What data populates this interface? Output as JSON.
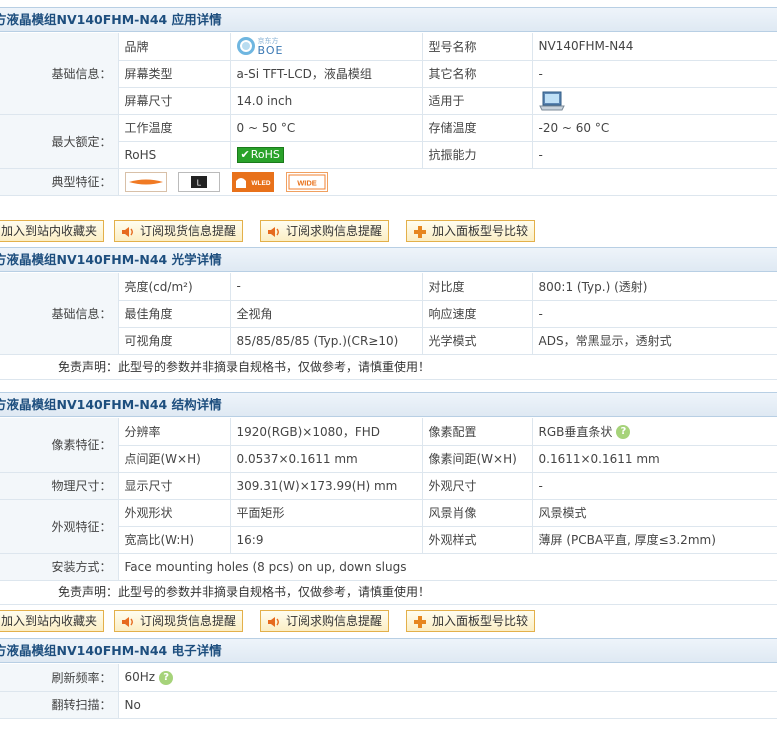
{
  "sections": {
    "app": {
      "title": "方液晶模组NV140FHM-N44 应用详情"
    },
    "optical": {
      "title": "方液晶模组NV140FHM-N44 光学详情"
    },
    "structure": {
      "title": "方液晶模组NV140FHM-N44 结构详情"
    },
    "electronic": {
      "title": "方液晶模组NV140FHM-N44 电子详情"
    }
  },
  "app": {
    "basic_group": "基础信息：",
    "rating_group": "最大额定：",
    "feature_group": "典型特征：",
    "brand_label": "品牌",
    "brand_logo_name": "京东方",
    "brand_logo_text": "BOE",
    "model_label": "型号名称",
    "model_value": "NV140FHM-N44",
    "screen_type_label": "屏幕类型",
    "screen_type_value": "a-Si TFT-LCD，液晶模组",
    "other_name_label": "其它名称",
    "other_name_value": "-",
    "screen_size_label": "屏幕尺寸",
    "screen_size_value": "14.0 inch",
    "suitable_label": "适用于",
    "work_temp_label": "工作温度",
    "work_temp_value": "0 ~ 50 °C",
    "storage_temp_label": "存储温度",
    "storage_temp_value": "-20 ~ 60 °C",
    "rohs_label": "RoHS",
    "rohs_badge": "RoHS",
    "vibration_label": "抗振能力",
    "vibration_value": "-",
    "feature_l": "L",
    "feature_wled": "WLED",
    "feature_wide": "WIDE"
  },
  "actions": {
    "favorite": "加入到站内收藏夹",
    "stock_alert": "订阅现货信息提醒",
    "buy_alert": "订阅求购信息提醒",
    "compare": "加入面板型号比较"
  },
  "optical": {
    "basic_group": "基础信息：",
    "brightness_label": "亮度(cd/m²)",
    "brightness_value": "-",
    "contrast_label": "对比度",
    "contrast_value": "800:1 (Typ.) (透射)",
    "best_angle_label": "最佳角度",
    "best_angle_value": "全视角",
    "response_label": "响应速度",
    "response_value": "-",
    "view_angle_label": "可视角度",
    "view_angle_value": "85/85/85/85 (Typ.)(CR≥10)",
    "optical_mode_label": "光学模式",
    "optical_mode_value": "ADS，常黑显示，透射式",
    "disclaimer": "免责声明：此型号的参数并非摘录自规格书，仅做参考，请慎重使用！"
  },
  "structure": {
    "pixel_group": "像素特征：",
    "physical_group": "物理尺寸：",
    "appearance_group": "外观特征：",
    "mount_group": "安装方式：",
    "resolution_label": "分辨率",
    "resolution_value": "1920(RGB)×1080，FHD",
    "pixel_config_label": "像素配置",
    "pixel_config_value": "RGB垂直条状",
    "dot_pitch_label": "点间距(W×H)",
    "dot_pitch_value": "0.0537×0.1611 mm",
    "pixel_pitch_label": "像素间距(W×H)",
    "pixel_pitch_value": "0.1611×0.1611 mm",
    "display_size_label": "显示尺寸",
    "display_size_value": "309.31(W)×173.99(H) mm",
    "outline_label": "外观尺寸",
    "outline_value": "-",
    "shape_label": "外观形状",
    "shape_value": "平面矩形",
    "orientation_label": "风景肖像",
    "orientation_value": "风景模式",
    "aspect_label": "宽高比(W:H)",
    "aspect_value": "16:9",
    "style_label": "外观样式",
    "style_value": "薄屏 (PCBA平直, 厚度≤3.2mm)",
    "mount_value": "Face mounting holes (8 pcs) on up, down slugs",
    "disclaimer": "免责声明：此型号的参数并非摘录自规格书，仅做参考，请慎重使用！"
  },
  "electronic": {
    "refresh_label": "刷新频率：",
    "refresh_value": "60Hz",
    "flip_label": "翻转扫描：",
    "flip_value": "No"
  },
  "help_glyph": "?",
  "colors": {
    "header_text": "#1d4e7e",
    "rohs_green": "#2aa22a",
    "button_border": "#e3b04a",
    "wled_orange": "#e8711a"
  }
}
